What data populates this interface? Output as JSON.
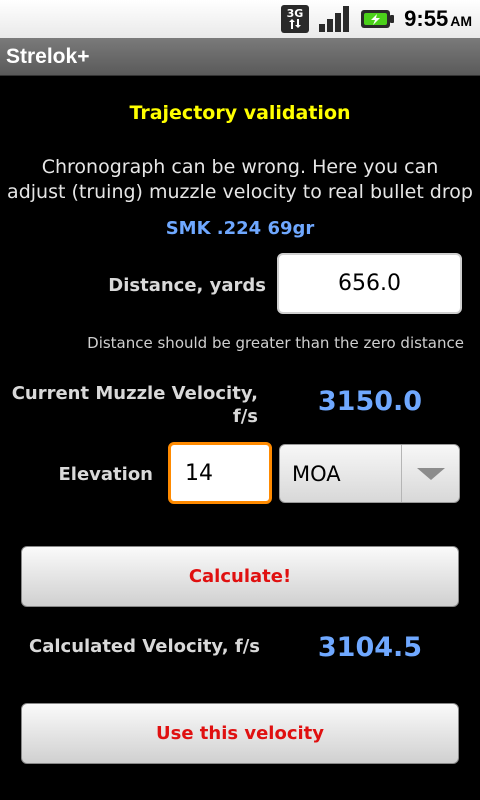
{
  "status_bar": {
    "network_type": "3G",
    "time": "9:55",
    "ampm": "AM",
    "icons": [
      "3g-data-icon",
      "signal-icon",
      "battery-charging-icon"
    ]
  },
  "app": {
    "title": "Strelok+"
  },
  "screen": {
    "heading": "Trajectory validation",
    "description_line1": "Chronograph can be wrong. Here you can",
    "description_line2": "adjust (truing) muzzle velocity to real bullet drop",
    "bullet_name": "SMK .224 69gr"
  },
  "distance": {
    "label": "Distance, yards",
    "value": "656.0",
    "hint": "Distance should be greater than the zero distance"
  },
  "muzzle_velocity": {
    "label_line1": "Current Muzzle Velocity,",
    "label_line2": "f/s",
    "value": "3150.0"
  },
  "elevation": {
    "label": "Elevation",
    "value": "14",
    "unit_selected": "MOA"
  },
  "buttons": {
    "calculate": "Calculate!",
    "use_velocity": "Use this velocity"
  },
  "calculated": {
    "label": "Calculated Velocity, f/s",
    "value": "3104.5"
  },
  "colors": {
    "heading": "#ffff00",
    "accent_blue": "#6fa8ff",
    "button_text": "#e01010",
    "focus_border": "#ff8a00"
  }
}
